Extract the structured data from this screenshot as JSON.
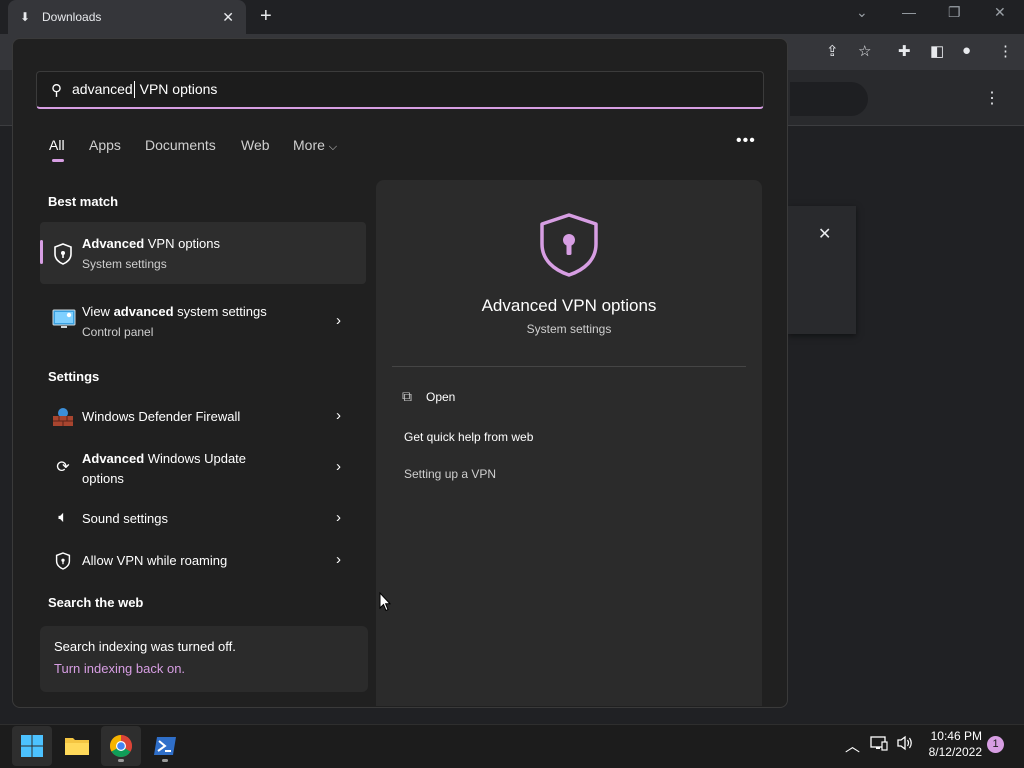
{
  "browser": {
    "tab_title": "Downloads",
    "new_tab": "+",
    "win_controls": [
      "⌄",
      "—",
      "❐",
      "✕"
    ]
  },
  "search": {
    "query_typed": "advanced",
    "query_suggested": " VPN options"
  },
  "filters": {
    "tabs": [
      "All",
      "Apps",
      "Documents",
      "Web",
      "More"
    ],
    "active": "All",
    "more_chevron": "⌵",
    "more_options": "•••"
  },
  "best_match": {
    "header": "Best match",
    "items": [
      {
        "bold": "Advanced",
        "rest": " VPN options",
        "sub": "System settings",
        "icon": "shield-icon"
      },
      {
        "pre": "View ",
        "bold": "advanced",
        "rest": " system settings",
        "sub": "Control panel",
        "icon": "monitor-settings-icon"
      }
    ]
  },
  "settings": {
    "header": "Settings",
    "items": [
      {
        "label": "Windows Defender Firewall",
        "icon": "firewall-icon"
      },
      {
        "bold": "Advanced",
        "rest": " Windows Update",
        "line2": "options",
        "icon": "sync-icon"
      },
      {
        "label": "Sound settings",
        "icon": "speaker-icon"
      },
      {
        "label": "Allow VPN while roaming",
        "icon": "shield-icon"
      }
    ]
  },
  "web": {
    "header": "Search the web",
    "indexing_off": "Search indexing was turned off.",
    "indexing_link": "Turn indexing back on."
  },
  "preview": {
    "title": "Advanced VPN options",
    "subtitle": "System settings",
    "open_label": "Open",
    "help_header": "Get quick help from web",
    "help_link": "Setting up a VPN"
  },
  "taskbar": {
    "apps": [
      "start-button",
      "file-explorer",
      "chrome",
      "powershell"
    ],
    "time": "10:46 PM",
    "date": "8/12/2022",
    "notifications": "1"
  },
  "colors": {
    "accent": "#d79ee3",
    "panel": "#202020",
    "preview": "#2b2b2b"
  }
}
